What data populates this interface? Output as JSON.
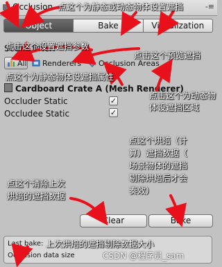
{
  "window": {
    "title": "Occlusion",
    "menu_glyph": "-≡"
  },
  "toolbar": {
    "tabs": [
      "Object",
      "Bake",
      "Visualization"
    ],
    "active_index": 0
  },
  "scene_filter": {
    "label": "Scene Filter:",
    "options": [
      {
        "label": "All",
        "icon": "all-icon",
        "selected": true
      },
      {
        "label": "Renderers",
        "icon": "renderers-icon",
        "selected": false
      },
      {
        "label": "Occlusion Areas",
        "icon": "occlusion-areas-icon",
        "selected": false
      }
    ]
  },
  "selection": {
    "name": "Cardboard Crate A (Mesh Renderer)",
    "fields": [
      {
        "label": "Occluder Static",
        "checked": true
      },
      {
        "label": "Occludee Static",
        "checked": true
      }
    ]
  },
  "buttons": {
    "clear": "Clear",
    "bake": "Bake"
  },
  "info": {
    "last_bake": "Last bake:",
    "data_size": "Occlusion data size"
  },
  "annotations": {
    "top": "点这个为静态或动态物体设置遮挡",
    "filter": "点击这个设置遮挡参数",
    "preview": "点击这个预览遮挡",
    "static_props": "点这个为静态物体设遮挡属性",
    "dynamic_area": [
      "点击这个为动态物",
      "体设遮挡区域"
    ],
    "bake": [
      "点这个烘焙（计",
      "算）遮挡数据（",
      "场景物体的遮挡",
      "剔除烘焙后才会",
      "奏效）"
    ],
    "clear": [
      "点这个清除上次",
      "烘焙的遮挡数据"
    ],
    "info": "上次烘焙的遮挡剔除数据大小"
  },
  "watermark": "CSDN @程序员_sam",
  "colors": {
    "arrow": "#e8101a",
    "active_tab": "#5a5a5a",
    "panel": "#c2c2c2"
  }
}
